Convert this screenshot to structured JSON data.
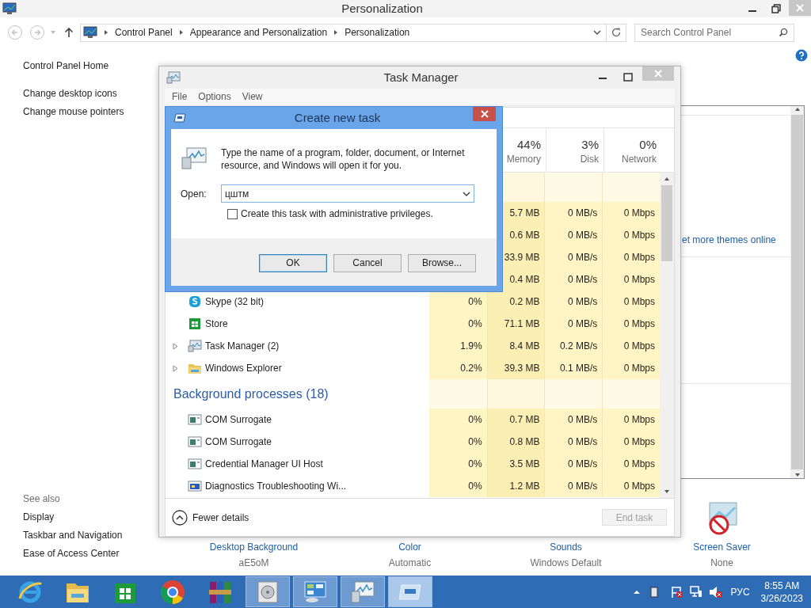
{
  "control_panel": {
    "title": "Personalization",
    "breadcrumb": [
      "Control Panel",
      "Appearance and Personalization",
      "Personalization"
    ],
    "search": {
      "placeholder": "Search Control Panel"
    },
    "sidebar": {
      "links": [
        "Control Panel Home",
        "Change desktop icons",
        "Change mouse pointers"
      ],
      "see_also_heading": "See also",
      "see_also": [
        "Display",
        "Taskbar and Navigation",
        "Ease of Access Center"
      ]
    },
    "themes_link": "et more themes online",
    "settings": [
      {
        "label": "Desktop Background",
        "value": "aE5oM"
      },
      {
        "label": "Color",
        "value": "Automatic"
      },
      {
        "label": "Sounds",
        "value": "Windows Default"
      },
      {
        "label": "Screen Saver",
        "value": "None",
        "kind": "screensaver"
      }
    ]
  },
  "task_manager": {
    "title": "Task Manager",
    "menu": [
      "File",
      "Options",
      "View"
    ],
    "columns": [
      {
        "percent": "44%",
        "label": "Memory"
      },
      {
        "percent": "3%",
        "label": "Disk"
      },
      {
        "percent": "0%",
        "label": "Network"
      }
    ],
    "rows": [
      {
        "kind": "group"
      },
      {
        "kind": "covered",
        "memory": "5.7 MB",
        "disk": "0 MB/s",
        "network": "0 Mbps"
      },
      {
        "kind": "covered",
        "memory": "0.6 MB",
        "disk": "0 MB/s",
        "network": "0 Mbps"
      },
      {
        "kind": "covered",
        "memory": "33.9 MB",
        "disk": "0 MB/s",
        "network": "0 Mbps"
      },
      {
        "kind": "covered",
        "memory": "0.4 MB",
        "disk": "0 MB/s",
        "network": "0 Mbps"
      },
      {
        "kind": "skype",
        "expandable": false,
        "name": "Skype (32 bit)",
        "cpu": "0%",
        "memory": "0.2 MB",
        "disk": "0 MB/s",
        "network": "0 Mbps"
      },
      {
        "kind": "store",
        "expandable": false,
        "name": "Store",
        "cpu": "0%",
        "memory": "71.1 MB",
        "disk": "0 MB/s",
        "network": "0 Mbps"
      },
      {
        "kind": "taskmgr",
        "expandable": true,
        "name": "Task Manager (2)",
        "cpu": "1.9%",
        "memory": "8.4 MB",
        "disk": "0.2 MB/s",
        "network": "0 Mbps"
      },
      {
        "kind": "folder",
        "expandable": true,
        "name": "Windows Explorer",
        "cpu": "0.2%",
        "memory": "39.3 MB",
        "disk": "0.1 MB/s",
        "network": "0 Mbps"
      },
      {
        "kind": "group",
        "label": "Background processes (18)"
      },
      {
        "kind": "window",
        "expandable": false,
        "name": "COM Surrogate",
        "cpu": "0%",
        "memory": "0.7 MB",
        "disk": "0 MB/s",
        "network": "0 Mbps"
      },
      {
        "kind": "window",
        "expandable": false,
        "name": "COM Surrogate",
        "cpu": "0%",
        "memory": "0.8 MB",
        "disk": "0 MB/s",
        "network": "0 Mbps"
      },
      {
        "kind": "window",
        "expandable": false,
        "name": "Credential Manager UI Host",
        "cpu": "0%",
        "memory": "3.5 MB",
        "disk": "0 MB/s",
        "network": "0 Mbps"
      },
      {
        "kind": "diag",
        "expandable": false,
        "name": "Diagnostics Troubleshooting Wi...",
        "cpu": "0%",
        "memory": "1.2 MB",
        "disk": "0 MB/s",
        "network": "0 Mbps"
      }
    ],
    "fewer_details": "Fewer details",
    "end_task": {
      "label": "End task",
      "disabled": true
    }
  },
  "dialog": {
    "title": "Create new task",
    "message": "Type the name of a program, folder, document, or Internet resource, and Windows will open it for you.",
    "open_label": "Open:",
    "value": "цштм",
    "checkbox": {
      "label": "Create this task with administrative privileges.",
      "checked": false
    },
    "buttons": [
      {
        "label": "OK",
        "default": true
      },
      {
        "label": "Cancel",
        "default": false
      },
      {
        "label": "Browse...",
        "default": false
      }
    ]
  },
  "taskbar": {
    "apps": [
      {
        "kind": "ie",
        "running": false,
        "selected": false
      },
      {
        "kind": "explorer",
        "running": false,
        "selected": false
      },
      {
        "kind": "store",
        "running": false,
        "selected": false
      },
      {
        "kind": "chrome",
        "running": false,
        "selected": false
      },
      {
        "kind": "winrar",
        "running": false,
        "selected": false
      },
      {
        "kind": "media",
        "running": true,
        "selected": false
      },
      {
        "kind": "controlpanel",
        "running": true,
        "selected": false
      },
      {
        "kind": "taskmgr",
        "running": true,
        "selected": false
      },
      {
        "kind": "run",
        "running": true,
        "selected": true
      }
    ],
    "language": "РУС",
    "time": "8:55 AM",
    "date": "3/26/2023"
  }
}
